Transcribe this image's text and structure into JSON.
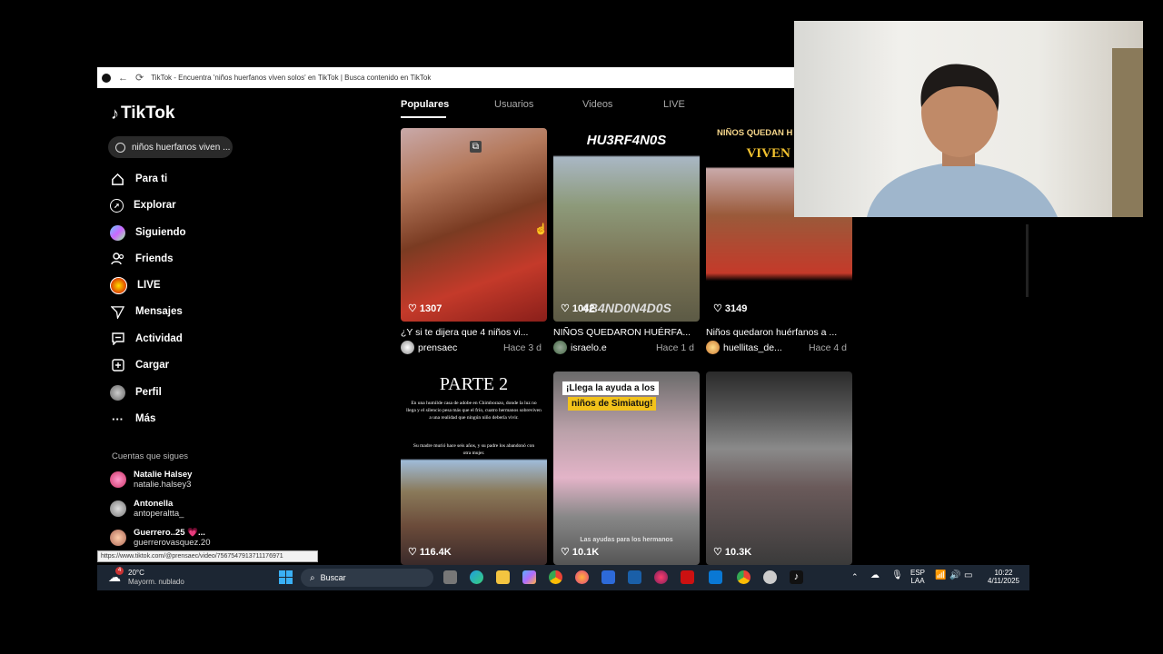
{
  "browser": {
    "title": "TikTok - Encuentra 'niños huerfanos viven solos' en TikTok | Busca contenido en TikTok"
  },
  "sidebar": {
    "logo": "TikTok",
    "search_value": "niños huerfanos viven ...",
    "nav": [
      {
        "label": "Para ti",
        "icon": "home-icon"
      },
      {
        "label": "Explorar",
        "icon": "compass-icon"
      },
      {
        "label": "Siguiendo",
        "icon": "following-avatar-icon"
      },
      {
        "label": "Friends",
        "icon": "friends-icon"
      },
      {
        "label": "LIVE",
        "icon": "live-icon"
      },
      {
        "label": "Mensajes",
        "icon": "send-icon"
      },
      {
        "label": "Actividad",
        "icon": "activity-icon"
      },
      {
        "label": "Cargar",
        "icon": "upload-icon"
      },
      {
        "label": "Perfil",
        "icon": "profile-avatar-icon"
      },
      {
        "label": "Más",
        "icon": "more-icon"
      }
    ],
    "following_header": "Cuentas que sigues",
    "following": [
      {
        "name": "Natalie Halsey",
        "handle": "natalie.halsey3"
      },
      {
        "name": "Antonella",
        "handle": "antoperaltta_"
      },
      {
        "name": "Guerrero..25 💗...",
        "handle": "guerrerovasquez.20"
      }
    ]
  },
  "tabs": [
    "Populares",
    "Usuarios",
    "Videos",
    "LIVE"
  ],
  "videos": [
    {
      "likes": "1307",
      "caption": "¿Y si te dijera que 4 niños vi...",
      "user": "prensaec",
      "date": "Hace 3 d",
      "overlay": ""
    },
    {
      "likes": "1042",
      "caption": "NIÑOS QUEDARON HUÉRFA...",
      "user": "israelo.e",
      "date": "Hace 1 d",
      "overlay": "HU3RF4N0S",
      "overlay2": "4B4ND0N4D0S"
    },
    {
      "likes": "3149",
      "caption": "Niños quedaron huérfanos a ...",
      "user": "huellitas_de...",
      "date": "Hace 4 d",
      "overlay": "NIÑOS QUEDAN H",
      "overlay2": "VIVEN SO"
    },
    {
      "likes": "116.4K",
      "caption": "",
      "user": "",
      "date": "",
      "overlay": "PARTE 2",
      "overlay2": "En una humilde casa de adobe en Chimborazo, donde la luz no llega y el silencio pesa más que el frío, cuatro hermanos sobreviven a una realidad que ningún niño debería vivir.",
      "overlay3": "Su madre murió hace seis años, y su padre los abandonó con otra mujer."
    },
    {
      "likes": "10.1K",
      "caption": "",
      "user": "",
      "date": "",
      "overlay": "¡Llega la ayuda a los",
      "overlay2": "niños de Simiatug!",
      "overlay3": "Las ayudas para los hermanos"
    },
    {
      "likes": "10.3K",
      "caption": "",
      "user": "",
      "date": "",
      "overlay": ""
    }
  ],
  "status_url": "https://www.tiktok.com/@prensaec/video/7567547913711176971",
  "taskbar": {
    "weather_temp": "20°C",
    "weather_desc": "Mayorm. nublado",
    "weather_badge": "4",
    "search": "Buscar",
    "lang1": "ESP",
    "lang2": "LAA",
    "time": "10:22",
    "date": "4/11/2025"
  }
}
